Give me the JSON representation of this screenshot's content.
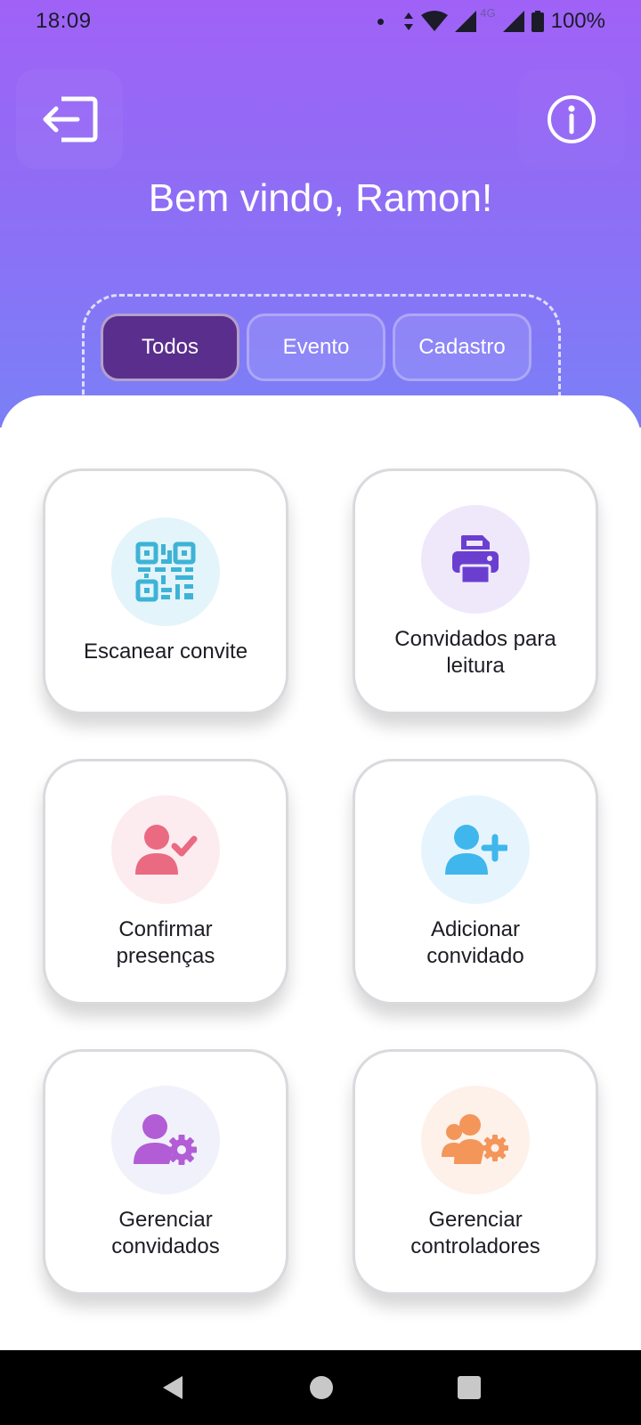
{
  "status_bar": {
    "time": "18:09",
    "network": "4G",
    "battery": "100%"
  },
  "header": {
    "welcome": "Bem vindo, Ramon!",
    "logout_icon": "logout-icon",
    "info_icon": "info-icon"
  },
  "tabs": [
    {
      "label": "Todos",
      "active": true
    },
    {
      "label": "Evento",
      "active": false
    },
    {
      "label": "Cadastro",
      "active": false
    }
  ],
  "cards": [
    {
      "label": "Escanear convite",
      "icon": "qr-code-icon",
      "color": "#3db3d6",
      "bg": "#e3f4fa"
    },
    {
      "label": "Convidados para\nleitura",
      "icon": "printer-icon",
      "color": "#6a3fd0",
      "bg": "#efe8fb"
    },
    {
      "label": "Confirmar\npresenças",
      "icon": "user-check-icon",
      "color": "#ea6a82",
      "bg": "#fdecef"
    },
    {
      "label": "Adicionar\nconvidado",
      "icon": "user-plus-icon",
      "color": "#3fb7ec",
      "bg": "#e6f5fd"
    },
    {
      "label": "Gerenciar\nconvidados",
      "icon": "user-gear-icon",
      "color": "#b25dd6",
      "bg": "#f1f1fb"
    },
    {
      "label": "Gerenciar\ncontroladores",
      "icon": "users-gear-icon",
      "color": "#f4955a",
      "bg": "#fdf1ea"
    }
  ],
  "nav": {
    "back_icon": "back-icon",
    "home_icon": "home-icon",
    "recents_icon": "recents-icon"
  }
}
